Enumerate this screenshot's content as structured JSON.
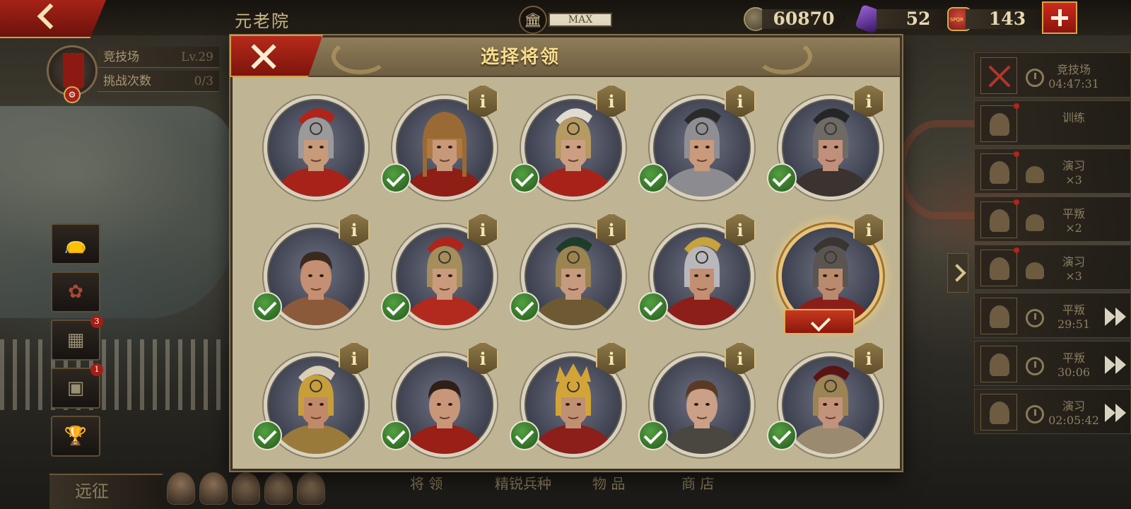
{
  "topbar": {
    "title": "元老院",
    "senate_level": "MAX",
    "coins": "60870",
    "gems": "52",
    "spqr": "143",
    "spqr_icon_text": "SPQR"
  },
  "arena_panel": {
    "name": "竞技场",
    "level": "Lv.29",
    "challenges_label": "挑战次数",
    "challenges_value": "0/3"
  },
  "left_menu": [
    {
      "icon": "money-bag-icon",
      "badge": ""
    },
    {
      "icon": "lotus-icon",
      "badge": ""
    },
    {
      "icon": "video-icon",
      "badge": "3"
    },
    {
      "icon": "chest-icon",
      "badge": "1"
    },
    {
      "icon": "trophy-icon",
      "badge": ""
    }
  ],
  "expedition_label": "远征",
  "bottom_tabs": [
    "将  领",
    "精锐兵种",
    "物  品",
    "商  店"
  ],
  "events": [
    {
      "title": "竞技场",
      "sub": "04:47:31",
      "icon": "swords-icon",
      "timer": true,
      "ff": false,
      "dot": false
    },
    {
      "title": "训练",
      "sub": "",
      "icon": "helmet-icon",
      "timer": false,
      "ff": false,
      "dot": true
    },
    {
      "title": "演习",
      "sub": "×3",
      "icon": "helmet-icon",
      "timer": false,
      "ff": false,
      "dot": true
    },
    {
      "title": "平叛",
      "sub": "×2",
      "icon": "helmet-icon",
      "timer": false,
      "ff": false,
      "dot": true
    },
    {
      "title": "演习",
      "sub": "×3",
      "icon": "helmet-icon",
      "timer": false,
      "ff": false,
      "dot": true
    },
    {
      "title": "平叛",
      "sub": "29:51",
      "icon": "helmet-icon",
      "timer": true,
      "ff": true,
      "dot": false
    },
    {
      "title": "平叛",
      "sub": "30:06",
      "icon": "helmet-icon",
      "timer": true,
      "ff": true,
      "dot": false
    },
    {
      "title": "演习",
      "sub": "02:05:42",
      "icon": "helmet-icon",
      "timer": true,
      "ff": true,
      "dot": false
    }
  ],
  "dialog": {
    "title": "选择将领",
    "info_glyph": "i"
  },
  "generals": [
    {
      "helmet": "#9a9a9a",
      "crest": "#b0241a",
      "cape": "#a7231a",
      "skin": "#c79a7a",
      "assigned": false,
      "info": false,
      "selected": false
    },
    {
      "helmet": "#b07a3e",
      "crest": "#b07a3e",
      "cape": "#8f1e16",
      "skin": "#c8987a",
      "assigned": true,
      "info": true,
      "selected": false,
      "lion": true
    },
    {
      "helmet": "#b59a62",
      "crest": "#e0dcd0",
      "cape": "#a7231a",
      "skin": "#cc9f82",
      "assigned": true,
      "info": true,
      "selected": false
    },
    {
      "helmet": "#8f8f93",
      "crest": "#2a2a2a",
      "cape": "#8c8c90",
      "skin": "#c99a7c",
      "assigned": true,
      "info": true,
      "selected": false
    },
    {
      "helmet": "#6e6a66",
      "crest": "#262626",
      "cape": "#3a3330",
      "skin": "#c0907a",
      "assigned": true,
      "info": true,
      "selected": false
    },
    {
      "helmet": "none",
      "crest": "none",
      "cape": "#8a5a3a",
      "skin": "#c48f72",
      "assigned": true,
      "info": true,
      "selected": false,
      "hair": "#3a2a1e"
    },
    {
      "helmet": "#a58e5c",
      "crest": "#b0241a",
      "cape": "#b22a1e",
      "skin": "#c99a7c",
      "assigned": true,
      "info": true,
      "selected": false
    },
    {
      "helmet": "#9c8450",
      "crest": "#1f3b2a",
      "cape": "#6e5a32",
      "skin": "#c59a7e",
      "assigned": true,
      "info": true,
      "selected": false
    },
    {
      "helmet": "#b8b8bc",
      "crest": "#c8a23c",
      "cape": "#8c1f1a",
      "skin": "#c28f72",
      "assigned": true,
      "info": true,
      "selected": false
    },
    {
      "helmet": "#5a5550",
      "crest": "#3a3530",
      "cape": "#8a1f1a",
      "skin": "#b98a6e",
      "assigned": false,
      "info": true,
      "selected": true
    },
    {
      "helmet": "#c79f3a",
      "crest": "#d8cfb8",
      "cape": "#9a7a3a",
      "skin": "#c08a6a",
      "assigned": true,
      "info": true,
      "selected": false
    },
    {
      "helmet": "none",
      "crest": "none",
      "cape": "#9a1f16",
      "skin": "#c8977a",
      "assigned": true,
      "info": true,
      "selected": false,
      "hair": "#2e2016"
    },
    {
      "helmet": "#d3a538",
      "crest": "#d3a538",
      "cape": "#8c1f1a",
      "skin": "#c09072",
      "assigned": true,
      "info": true,
      "selected": false,
      "crown": true
    },
    {
      "helmet": "none",
      "crest": "none",
      "cape": "#4a4640",
      "skin": "#caa086",
      "assigned": true,
      "info": true,
      "selected": false,
      "hair": "#5a3a22"
    },
    {
      "helmet": "#9c8454",
      "crest": "#5a1414",
      "cape": "#9a8a70",
      "skin": "#c2927a",
      "assigned": true,
      "info": true,
      "selected": false
    }
  ]
}
